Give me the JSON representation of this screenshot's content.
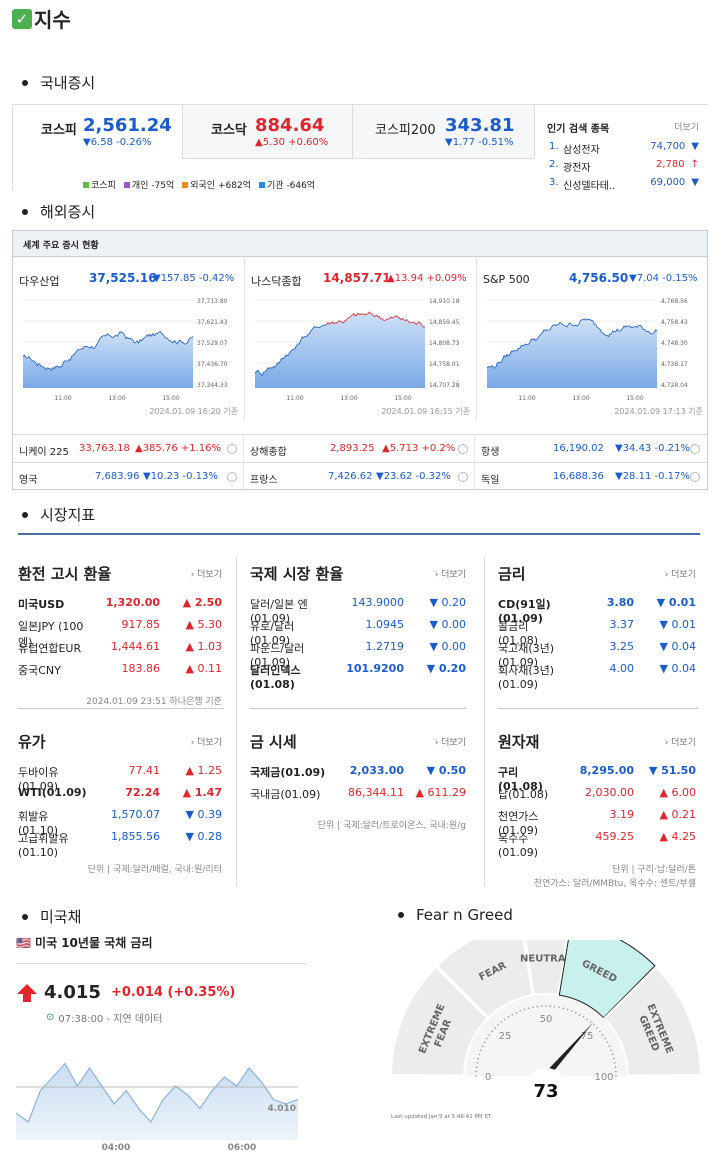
{
  "page_title": "지수",
  "sections": {
    "domestic": "국내증시",
    "overseas": "해외증시",
    "market": "시장지표",
    "us_bond": "미국채",
    "fear": "Fear n Greed"
  },
  "domestic": {
    "indices": [
      {
        "name": "코스피",
        "value": "2,561.24",
        "change": "▼6.58 -0.26%",
        "dir": "down"
      },
      {
        "name": "코스닥",
        "value": "884.64",
        "change": "▲5.30 +0.60%",
        "dir": "up"
      },
      {
        "name": "코스피200",
        "value": "343.81",
        "change": "▼1.77 -0.51%",
        "dir": "down"
      }
    ],
    "legend": [
      {
        "label": "코스피",
        "color": "#5cbf3f"
      },
      {
        "label": "개인 -75억",
        "color": "#9b59d0"
      },
      {
        "label": "외국인 +682억",
        "color": "#f08a24"
      },
      {
        "label": "기관 -646억",
        "color": "#2a8bdc"
      }
    ],
    "popular": {
      "title": "인기 검색 종목",
      "more": "더보기",
      "items": [
        {
          "rank": "1.",
          "name": "삼성전자",
          "value": "74,700",
          "arrow": "▼",
          "dir": "down"
        },
        {
          "rank": "2.",
          "name": "광전자",
          "value": "2,780",
          "arrow": "↑",
          "dir": "up"
        },
        {
          "rank": "3.",
          "name": "신성델타테..",
          "value": "69,000",
          "arrow": "▼",
          "dir": "down"
        }
      ]
    }
  },
  "overseas": {
    "header": "세계 주요 증시 현황",
    "panels": [
      {
        "name": "다우산업",
        "value": "37,525.16",
        "change": "▼157.85 -0.42%",
        "dir": "down",
        "yticks": [
          "37,713.80",
          "37,621.43",
          "37,529.07",
          "37,436.70",
          "37,344.33"
        ],
        "xticks": [
          "11:00",
          "13:00",
          "15:00"
        ],
        "stamp": "2024.01.09 16:20 기준"
      },
      {
        "name": "나스닥종합",
        "value": "14,857.71",
        "change": "▲13.94 +0.09%",
        "dir": "up",
        "yticks": [
          "14,910.18",
          "14,859.45",
          "14,808.73",
          "14,758.01",
          "14,707.28"
        ],
        "xticks": [
          "11:00",
          "13:00",
          "15:00"
        ],
        "stamp": "2024.01.09 16:15 기준"
      },
      {
        "name": "S&P 500",
        "value": "4,756.50",
        "change": "▼7.04 -0.15%",
        "dir": "down",
        "yticks": [
          "4,768.56",
          "4,758.43",
          "4,748.30",
          "4,738.17",
          "4,728.04"
        ],
        "xticks": [
          "11:00",
          "13:00",
          "15:00"
        ],
        "stamp": "2024.01.09 17:13 기준"
      }
    ],
    "rows": [
      [
        {
          "name": "니케이 225",
          "value": "33,763.18",
          "change": "▲385.76 +1.16%",
          "dir": "up"
        },
        {
          "name": "상해종합",
          "value": "2,893.25",
          "change": "▲5.713 +0.2%",
          "dir": "up"
        },
        {
          "name": "항생",
          "value": "16,190.02",
          "change": "▼34.43 -0.21%",
          "dir": "down"
        }
      ],
      [
        {
          "name": "영국",
          "value": "7,683.96",
          "change": "▼10.23 -0.13%",
          "dir": "down"
        },
        {
          "name": "프랑스",
          "value": "7,426.62",
          "change": "▼23.62 -0.32%",
          "dir": "down"
        },
        {
          "name": "독일",
          "value": "16,688.36",
          "change": "▼28.11 -0.17%",
          "dir": "down"
        }
      ]
    ]
  },
  "market": {
    "more": "더보기",
    "exchange": {
      "title": "환전 고시 환율",
      "rows": [
        {
          "name": "미국USD",
          "value": "1,320.00",
          "change": "▲ 2.50",
          "dir": "up",
          "bold": true
        },
        {
          "name": "일본JPY (100엔)",
          "value": "917.85",
          "change": "▲ 5.30",
          "dir": "up"
        },
        {
          "name": "유럽연합EUR",
          "value": "1,444.61",
          "change": "▲ 1.03",
          "dir": "up"
        },
        {
          "name": "중국CNY",
          "value": "183.86",
          "change": "▲ 0.11",
          "dir": "up"
        }
      ],
      "note": "2024.01.09 23:51 하나은행 기준"
    },
    "intl": {
      "title": "국제 시장 환율",
      "rows": [
        {
          "name": "달러/일본 엔(01.09)",
          "value": "143.9000",
          "change": "▼ 0.20",
          "dir": "down"
        },
        {
          "name": "유로/달러(01.09)",
          "value": "1.0945",
          "change": "▼ 0.00",
          "dir": "down"
        },
        {
          "name": "파운드/달러(01.09)",
          "value": "1.2719",
          "change": "▼ 0.00",
          "dir": "down"
        },
        {
          "name": "달러인덱스(01.08)",
          "value": "101.9200",
          "change": "▼ 0.20",
          "dir": "down",
          "bold": true
        }
      ]
    },
    "rate": {
      "title": "금리",
      "rows": [
        {
          "name": "CD(91일)(01.09)",
          "value": "3.80",
          "change": "▼ 0.01",
          "dir": "down",
          "bold": true
        },
        {
          "name": "콜금리(01.08)",
          "value": "3.37",
          "change": "▼ 0.01",
          "dir": "down"
        },
        {
          "name": "국고채(3년)(01.09)",
          "value": "3.25",
          "change": "▼ 0.04",
          "dir": "down"
        },
        {
          "name": "회사채(3년)(01.09)",
          "value": "4.00",
          "change": "▼ 0.04",
          "dir": "down"
        }
      ]
    },
    "oil": {
      "title": "유가",
      "rows": [
        {
          "name": "두바이유(01.09)",
          "value": "77.41",
          "change": "▲ 1.25",
          "dir": "up"
        },
        {
          "name": "WTI(01.09)",
          "value": "72.24",
          "change": "▲ 1.47",
          "dir": "up",
          "bold": true
        },
        {
          "name": "휘발유(01.10)",
          "value": "1,570.07",
          "change": "▼ 0.39",
          "dir": "down"
        },
        {
          "name": "고급휘발유(01.10)",
          "value": "1,855.56",
          "change": "▼ 0.28",
          "dir": "down"
        }
      ],
      "note": "단위 | 국제:달러/배럴, 국내:원/리터"
    },
    "gold": {
      "title": "금 시세",
      "rows": [
        {
          "name": "국제금(01.09)",
          "value": "2,033.00",
          "change": "▼ 0.50",
          "dir": "down",
          "bold": true
        },
        {
          "name": "국내금(01.09)",
          "value": "86,344.11",
          "change": "▲ 611.29",
          "dir": "up"
        }
      ],
      "note": "단위 | 국제:달러/트로이온스, 국내:원/g"
    },
    "raw": {
      "title": "원자재",
      "rows": [
        {
          "name": "구리(01.08)",
          "value": "8,295.00",
          "change": "▼ 51.50",
          "dir": "down",
          "bold": true
        },
        {
          "name": "납(01.08)",
          "value": "2,030.00",
          "change": "▲ 6.00",
          "dir": "up"
        },
        {
          "name": "천연가스(01.09)",
          "value": "3.19",
          "change": "▲ 0.21",
          "dir": "up"
        },
        {
          "name": "옥수수(01.09)",
          "value": "459.25",
          "change": "▲ 4.25",
          "dir": "up"
        }
      ],
      "note1": "단위 | 구리·납:달러/톤",
      "note2": "천연가스: 달러/MMBtu, 옥수수: 센트/부셸"
    }
  },
  "bond": {
    "flag": "🇺🇸",
    "title": "미국 10년물 국채 금리",
    "value": "4.015",
    "change": "+0.014 (+0.35%)",
    "time": "07:38:00 - 지연 데이터",
    "label_right": "4.010",
    "xticks": [
      "04:00",
      "06:00"
    ]
  },
  "fear_greed": {
    "labels": [
      "EXTREME FEAR",
      "FEAR",
      "NEUTRAL",
      "GREED",
      "EXTREME GREED"
    ],
    "ticks": [
      "0",
      "25",
      "50",
      "75",
      "100"
    ],
    "value": 73,
    "updated": "Last updated Jan 9 at 5:46:41 PM ET"
  }
}
